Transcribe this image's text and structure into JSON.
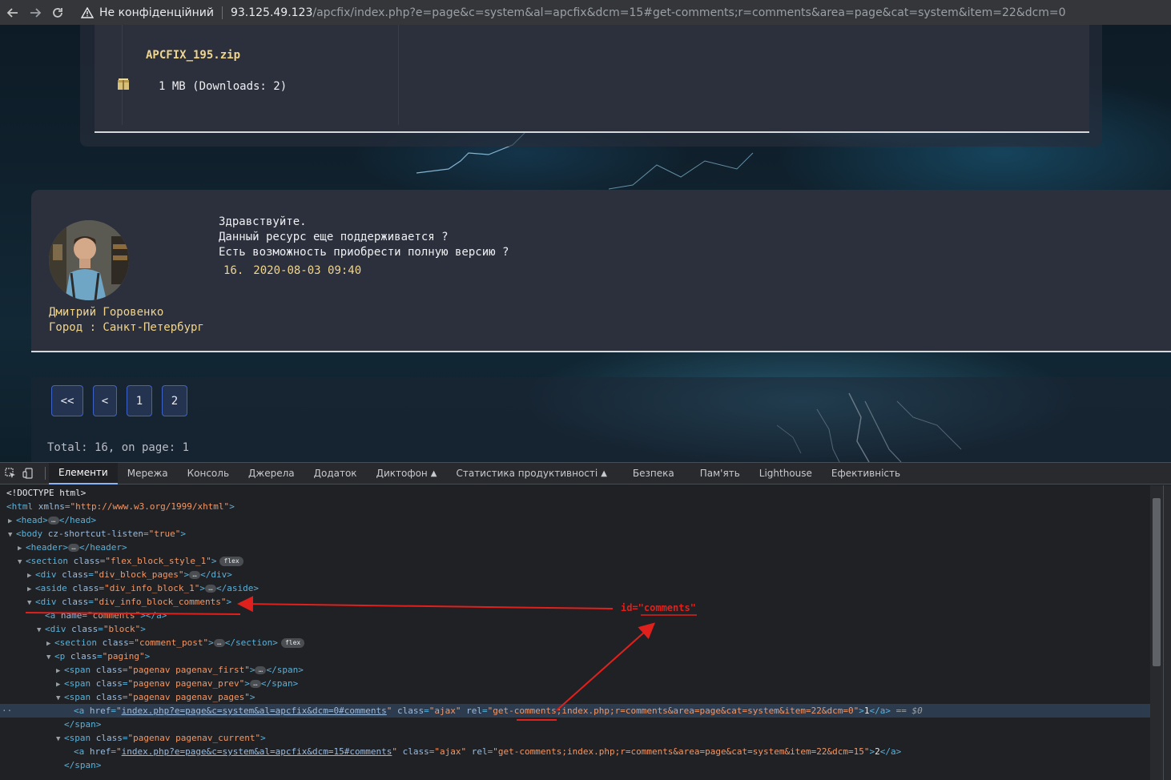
{
  "browser": {
    "security_label": "Не конфіденційний",
    "url_host": "93.125.49.123",
    "url_path": "/apcfix/index.php?e=page&c=system&al=apcfix&dcm=15#get-comments;r=comments&area=page&cat=system&item=22&dcm=0"
  },
  "file": {
    "name": "APCFIX_195.zip",
    "size_text": "1 MB (Downloads: 2)"
  },
  "comment": {
    "author": "Дмитрий Горовенко",
    "city": "Город : Санкт-Петербург",
    "lines": [
      "Здравствуйте.",
      "Данный ресурс еще поддерживается ?",
      "Есть возможность приобрести полную версию ?"
    ],
    "number": "16.",
    "datetime": "2020-08-03 09:40"
  },
  "pagination": {
    "first": "<<",
    "prev": "<",
    "pages": [
      "1",
      "2"
    ],
    "total_text": "Total: 16, on page: 1"
  },
  "devtools": {
    "tabs": [
      "Елементи",
      "Мережа",
      "Консоль",
      "Джерела",
      "Додаток",
      "Диктофон",
      "Статистика продуктивності",
      "Безпека",
      "Пам'ять",
      "Lighthouse",
      "Ефективність"
    ],
    "active_tab": "Елементи",
    "dom": {
      "doctype": "<!DOCTYPE html>",
      "html_open": "<html",
      "html_attr": "xmlns",
      "html_val": "\"http://www.w3.org/1999/xhtml\"",
      "html_close": ">",
      "head": "<head>",
      "head_close": "</head>",
      "body_open": "<body",
      "body_attr": "cz-shortcut-listen",
      "body_val": "\"true\"",
      "header": "<header>",
      "header_close": "</header>",
      "section_attr_val": "\"flex_block_style_1\"",
      "div_pages_val": "\"div_block_pages\"",
      "aside_val": "\"div_info_block_1\"",
      "comments_val": "\"div_info_block_comments\"",
      "a_name_val": "\"comments\"",
      "block_val": "\"block\"",
      "comment_post_val": "\"comment_post\"",
      "paging_val": "\"paging\"",
      "pn_first_val": "\"pagenav pagenav_first\"",
      "pn_prev_val": "\"pagenav pagenav_prev\"",
      "pn_pages_val": "\"pagenav pagenav_pages\"",
      "pn_current_val": "\"pagenav pagenav_current\"",
      "a1_href": "index.php?e=page&c=system&al=apcfix&dcm=0#comments",
      "a1_class": "\"ajax\"",
      "a1_rel": "\"get-comments;index.php;r=comments&area=page&cat=system&item=22&dcm=0\"",
      "a1_text": "1",
      "a1_tail": "== $0",
      "a2_href": "index.php?e=page&c=system&al=apcfix&dcm=15#comments",
      "a2_class": "\"ajax\"",
      "a2_rel": "\"get-comments;index.php;r=comments&area=page&cat=system&item=22&dcm=15\"",
      "a2_text": "2",
      "flex_badge": "flex"
    },
    "annotation": {
      "prefix": "id=\"",
      "word": "comments",
      "suffix": "\""
    }
  }
}
